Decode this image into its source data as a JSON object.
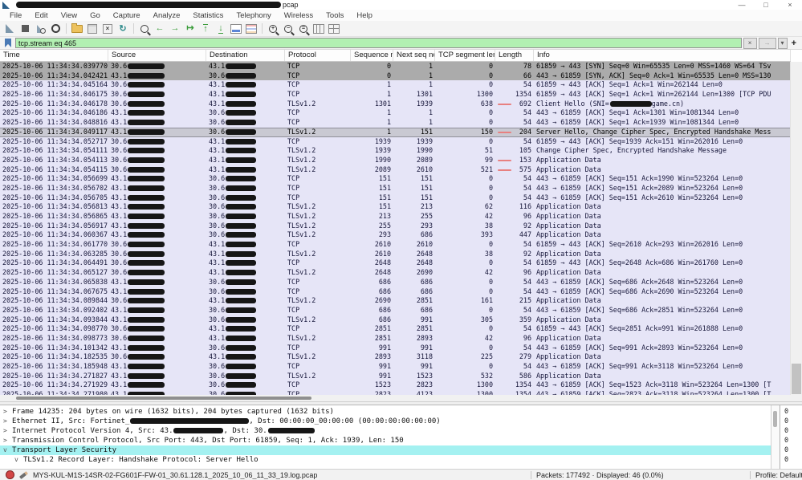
{
  "window": {
    "title_suffix": "pcap"
  },
  "menu": [
    "File",
    "Edit",
    "View",
    "Go",
    "Capture",
    "Analyze",
    "Statistics",
    "Telephony",
    "Wireless",
    "Tools",
    "Help"
  ],
  "toolbar": [
    "start-capture",
    "stop-capture",
    "capture-options",
    "capture-filters",
    "sep",
    "open-file",
    "save-file",
    "close-file",
    "reload",
    "sep",
    "find-packet",
    "go-back",
    "go-forward",
    "go-to-packet",
    "go-top",
    "go-bottom",
    "auto-scroll",
    "colorize",
    "sep",
    "zoom-in",
    "zoom-out",
    "zoom-reset",
    "resize-columns",
    "layout-grid"
  ],
  "filter": {
    "value": "tcp.stream eq 465",
    "clear_label": "×",
    "apply_label": "→",
    "dropdown_label": "▾",
    "add_label": "+"
  },
  "packet_list": {
    "columns": [
      "Time",
      "Source",
      "Destination",
      "Protocol",
      "Sequence no",
      "Next seq no",
      "TCP segment length",
      "Length",
      "Info"
    ],
    "rows": [
      {
        "t": "2025-10-06 11:34:34.039770",
        "s": "30.6",
        "d": "43.1",
        "p": "TCP",
        "seq": "0",
        "nxt": "1",
        "seg": "0",
        "len": "78",
        "info": "61859 → 443 [SYN] Seq=0 Win=65535 Len=0 MSS=1460 WS=64 TSv",
        "g": true
      },
      {
        "t": "2025-10-06 11:34:34.042421",
        "s": "43.1",
        "d": "30.6",
        "p": "TCP",
        "seq": "0",
        "nxt": "1",
        "seg": "0",
        "len": "66",
        "info": "443 → 61859 [SYN, ACK] Seq=0 Ack=1 Win=65535 Len=0 MSS=130",
        "g": true
      },
      {
        "t": "2025-10-06 11:34:34.045164",
        "s": "30.6",
        "d": "43.1",
        "p": "TCP",
        "seq": "1",
        "nxt": "1",
        "seg": "0",
        "len": "54",
        "info": "61859 → 443 [ACK] Seq=1 Ack=1 Win=262144 Len=0"
      },
      {
        "t": "2025-10-06 11:34:34.046175",
        "s": "30.6",
        "d": "43.1",
        "p": "TCP",
        "seq": "1",
        "nxt": "1301",
        "seg": "1300",
        "len": "1354",
        "info": "61859 → 443 [ACK] Seq=1 Ack=1 Win=262144 Len=1300 [TCP PDU"
      },
      {
        "t": "2025-10-06 11:34:34.046178",
        "s": "30.6",
        "d": "43.1",
        "p": "TLSv1.2",
        "seq": "1301",
        "nxt": "1939",
        "seg": "638",
        "len": "692",
        "ip": [
          "Client Hello (SNI=",
          {
            "r": 52
          },
          "game.cn)"
        ],
        "mark": true
      },
      {
        "t": "2025-10-06 11:34:34.046186",
        "s": "43.1",
        "d": "30.6",
        "p": "TCP",
        "seq": "1",
        "nxt": "1",
        "seg": "0",
        "len": "54",
        "info": "443 → 61859 [ACK] Seq=1 Ack=1301 Win=1081344 Len=0"
      },
      {
        "t": "2025-10-06 11:34:34.048816",
        "s": "43.1",
        "d": "30.6",
        "p": "TCP",
        "seq": "1",
        "nxt": "1",
        "seg": "0",
        "len": "54",
        "info": "443 → 61859 [ACK] Seq=1 Ack=1939 Win=1081344 Len=0"
      },
      {
        "t": "2025-10-06 11:34:34.049117",
        "s": "43.1",
        "d": "30.6",
        "p": "TLSv1.2",
        "seq": "1",
        "nxt": "151",
        "seg": "150",
        "len": "204",
        "info": "Server Hello, Change Cipher Spec, Encrypted Handshake Mess",
        "sel": true,
        "mark": true
      },
      {
        "t": "2025-10-06 11:34:34.052717",
        "s": "30.6",
        "d": "43.1",
        "p": "TCP",
        "seq": "1939",
        "nxt": "1939",
        "seg": "0",
        "len": "54",
        "info": "61859 → 443 [ACK] Seq=1939 Ack=151 Win=262016 Len=0"
      },
      {
        "t": "2025-10-06 11:34:34.054111",
        "s": "30.6",
        "d": "43.1",
        "p": "TLSv1.2",
        "seq": "1939",
        "nxt": "1990",
        "seg": "51",
        "len": "105",
        "info": "Change Cipher Spec, Encrypted Handshake Message"
      },
      {
        "t": "2025-10-06 11:34:34.054113",
        "s": "30.6",
        "d": "43.1",
        "p": "TLSv1.2",
        "seq": "1990",
        "nxt": "2089",
        "seg": "99",
        "len": "153",
        "info": "Application Data",
        "mark": true
      },
      {
        "t": "2025-10-06 11:34:34.054115",
        "s": "30.6",
        "d": "43.1",
        "p": "TLSv1.2",
        "seq": "2089",
        "nxt": "2610",
        "seg": "521",
        "len": "575",
        "info": "Application Data",
        "mark": true
      },
      {
        "t": "2025-10-06 11:34:34.056699",
        "s": "43.1",
        "d": "30.6",
        "p": "TCP",
        "seq": "151",
        "nxt": "151",
        "seg": "0",
        "len": "54",
        "info": "443 → 61859 [ACK] Seq=151 Ack=1990 Win=523264 Len=0"
      },
      {
        "t": "2025-10-06 11:34:34.056702",
        "s": "43.1",
        "d": "30.6",
        "p": "TCP",
        "seq": "151",
        "nxt": "151",
        "seg": "0",
        "len": "54",
        "info": "443 → 61859 [ACK] Seq=151 Ack=2089 Win=523264 Len=0"
      },
      {
        "t": "2025-10-06 11:34:34.056705",
        "s": "43.1",
        "d": "30.6",
        "p": "TCP",
        "seq": "151",
        "nxt": "151",
        "seg": "0",
        "len": "54",
        "info": "443 → 61859 [ACK] Seq=151 Ack=2610 Win=523264 Len=0"
      },
      {
        "t": "2025-10-06 11:34:34.056813",
        "s": "43.1",
        "d": "30.6",
        "p": "TLSv1.2",
        "seq": "151",
        "nxt": "213",
        "seg": "62",
        "len": "116",
        "info": "Application Data"
      },
      {
        "t": "2025-10-06 11:34:34.056865",
        "s": "43.1",
        "d": "30.6",
        "p": "TLSv1.2",
        "seq": "213",
        "nxt": "255",
        "seg": "42",
        "len": "96",
        "info": "Application Data"
      },
      {
        "t": "2025-10-06 11:34:34.056917",
        "s": "43.1",
        "d": "30.6",
        "p": "TLSv1.2",
        "seq": "255",
        "nxt": "293",
        "seg": "38",
        "len": "92",
        "info": "Application Data"
      },
      {
        "t": "2025-10-06 11:34:34.060367",
        "s": "43.1",
        "d": "30.6",
        "p": "TLSv1.2",
        "seq": "293",
        "nxt": "686",
        "seg": "393",
        "len": "447",
        "info": "Application Data"
      },
      {
        "t": "2025-10-06 11:34:34.061770",
        "s": "30.6",
        "d": "43.1",
        "p": "TCP",
        "seq": "2610",
        "nxt": "2610",
        "seg": "0",
        "len": "54",
        "info": "61859 → 443 [ACK] Seq=2610 Ack=293 Win=262016 Len=0"
      },
      {
        "t": "2025-10-06 11:34:34.063285",
        "s": "30.6",
        "d": "43.1",
        "p": "TLSv1.2",
        "seq": "2610",
        "nxt": "2648",
        "seg": "38",
        "len": "92",
        "info": "Application Data"
      },
      {
        "t": "2025-10-06 11:34:34.064491",
        "s": "30.6",
        "d": "43.1",
        "p": "TCP",
        "seq": "2648",
        "nxt": "2648",
        "seg": "0",
        "len": "54",
        "info": "61859 → 443 [ACK] Seq=2648 Ack=686 Win=261760 Len=0"
      },
      {
        "t": "2025-10-06 11:34:34.065127",
        "s": "30.6",
        "d": "43.1",
        "p": "TLSv1.2",
        "seq": "2648",
        "nxt": "2690",
        "seg": "42",
        "len": "96",
        "info": "Application Data"
      },
      {
        "t": "2025-10-06 11:34:34.065838",
        "s": "43.1",
        "d": "30.6",
        "p": "TCP",
        "seq": "686",
        "nxt": "686",
        "seg": "0",
        "len": "54",
        "info": "443 → 61859 [ACK] Seq=686 Ack=2648 Win=523264 Len=0"
      },
      {
        "t": "2025-10-06 11:34:34.067675",
        "s": "43.1",
        "d": "30.6",
        "p": "TCP",
        "seq": "686",
        "nxt": "686",
        "seg": "0",
        "len": "54",
        "info": "443 → 61859 [ACK] Seq=686 Ack=2690 Win=523264 Len=0"
      },
      {
        "t": "2025-10-06 11:34:34.089844",
        "s": "30.6",
        "d": "43.1",
        "p": "TLSv1.2",
        "seq": "2690",
        "nxt": "2851",
        "seg": "161",
        "len": "215",
        "info": "Application Data"
      },
      {
        "t": "2025-10-06 11:34:34.092402",
        "s": "43.1",
        "d": "30.6",
        "p": "TCP",
        "seq": "686",
        "nxt": "686",
        "seg": "0",
        "len": "54",
        "info": "443 → 61859 [ACK] Seq=686 Ack=2851 Win=523264 Len=0"
      },
      {
        "t": "2025-10-06 11:34:34.093844",
        "s": "43.1",
        "d": "30.6",
        "p": "TLSv1.2",
        "seq": "686",
        "nxt": "991",
        "seg": "305",
        "len": "359",
        "info": "Application Data"
      },
      {
        "t": "2025-10-06 11:34:34.098770",
        "s": "30.6",
        "d": "43.1",
        "p": "TCP",
        "seq": "2851",
        "nxt": "2851",
        "seg": "0",
        "len": "54",
        "info": "61859 → 443 [ACK] Seq=2851 Ack=991 Win=261888 Len=0"
      },
      {
        "t": "2025-10-06 11:34:34.098773",
        "s": "30.6",
        "d": "43.1",
        "p": "TLSv1.2",
        "seq": "2851",
        "nxt": "2893",
        "seg": "42",
        "len": "96",
        "info": "Application Data"
      },
      {
        "t": "2025-10-06 11:34:34.101342",
        "s": "43.1",
        "d": "30.6",
        "p": "TCP",
        "seq": "991",
        "nxt": "991",
        "seg": "0",
        "len": "54",
        "info": "443 → 61859 [ACK] Seq=991 Ack=2893 Win=523264 Len=0"
      },
      {
        "t": "2025-10-06 11:34:34.182535",
        "s": "30.6",
        "d": "43.1",
        "p": "TLSv1.2",
        "seq": "2893",
        "nxt": "3118",
        "seg": "225",
        "len": "279",
        "info": "Application Data"
      },
      {
        "t": "2025-10-06 11:34:34.185948",
        "s": "43.1",
        "d": "30.6",
        "p": "TCP",
        "seq": "991",
        "nxt": "991",
        "seg": "0",
        "len": "54",
        "info": "443 → 61859 [ACK] Seq=991 Ack=3118 Win=523264 Len=0"
      },
      {
        "t": "2025-10-06 11:34:34.271827",
        "s": "43.1",
        "d": "30.6",
        "p": "TLSv1.2",
        "seq": "991",
        "nxt": "1523",
        "seg": "532",
        "len": "586",
        "info": "Application Data"
      },
      {
        "t": "2025-10-06 11:34:34.271929",
        "s": "43.1",
        "d": "30.6",
        "p": "TCP",
        "seq": "1523",
        "nxt": "2823",
        "seg": "1300",
        "len": "1354",
        "info": "443 → 61859 [ACK] Seq=1523 Ack=3118 Win=523264 Len=1300 [T"
      },
      {
        "t": "2025-10-06 11:34:34.271980",
        "s": "43.1",
        "d": "30.6",
        "p": "TCP",
        "seq": "2823",
        "nxt": "4123",
        "seg": "1300",
        "len": "1354",
        "info": "443 → 61859 [ACK] Seq=2823 Ack=3118 Win=523264 Len=1300 [T"
      }
    ]
  },
  "details": {
    "lines": [
      {
        "exp": "collapsed",
        "parts": [
          "Frame 14235: 204 bytes on wire (1632 bits), 204 bytes captured (1632 bits)"
        ]
      },
      {
        "exp": "collapsed",
        "parts": [
          "Ethernet II, Src: Fortinet_",
          {
            "r": 148
          },
          ", Dst: 00:00:00_00:00:00 (00:00:00:00:00:00)"
        ]
      },
      {
        "exp": "collapsed",
        "parts": [
          "Internet Protocol Version 4, Src: 43.",
          {
            "r": 62
          },
          ", Dst: 30.",
          {
            "r": 58
          }
        ]
      },
      {
        "exp": "collapsed",
        "parts": [
          "Transmission Control Protocol, Src Port: 443, Dst Port: 61859, Seq: 1, Ack: 1939, Len: 150"
        ]
      },
      {
        "exp": "expanded",
        "selected": true,
        "parts": [
          "Transport Layer Security"
        ]
      },
      {
        "exp": "expanded",
        "indent": 1,
        "parts": [
          "TLSv1.2 Record Layer: Handshake Protocol: Server Hello"
        ]
      }
    ]
  },
  "bytes_pane": [
    "0",
    "0",
    "0",
    "0",
    "0",
    "0"
  ],
  "status": {
    "filename": "MYS-KUL-M1S-14SR-02-FG601F-FW-01_30.61.128.1_2025_10_06_11_33_19.log.pcap",
    "packets": "Packets: 177492 · Displayed: 46 (0.0%)",
    "profile": "Profile: Default"
  }
}
